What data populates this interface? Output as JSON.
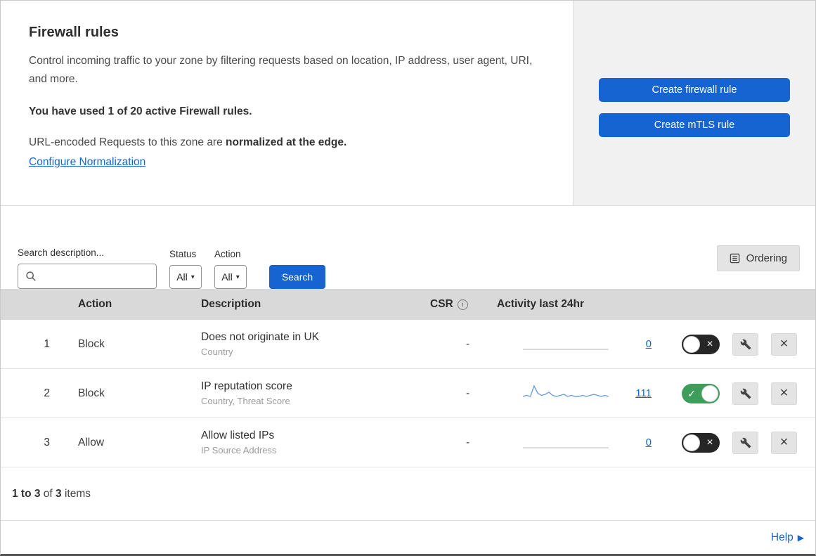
{
  "colors": {
    "accent_blue": "#1664d1",
    "link_blue": "#1664d1",
    "toggle_green": "#3f9d5c",
    "toggle_off_dark": "#262626",
    "table_header_gray": "#d9d9d9",
    "sparkline_blue": "#6d9ee3",
    "panel_gray": "#f1f1f1"
  },
  "header": {
    "title": "Firewall rules",
    "description": "Control incoming traffic to your zone by filtering requests based on location, IP address, user agent, URI, and more.",
    "usage": "You have used 1 of 20 active Firewall rules.",
    "normalization_text": "URL-encoded Requests to this zone are ",
    "normalization_bold": "normalized at the edge.",
    "normalization_link": "Configure Normalization",
    "create_firewall_rule": "Create firewall rule",
    "create_mtls_rule": "Create mTLS rule"
  },
  "filters": {
    "search_label": "Search description...",
    "status_label": "Status",
    "status_value": "All",
    "action_label": "Action",
    "action_value": "All",
    "search_button": "Search",
    "ordering_button": "Ordering"
  },
  "table": {
    "headers": {
      "action": "Action",
      "description": "Description",
      "csr": "CSR",
      "activity": "Activity last 24hr"
    },
    "rows": [
      {
        "priority": "1",
        "action": "Block",
        "description": "Does not originate in UK",
        "criteria": "Country",
        "csr": "-",
        "activity_count": "0",
        "enabled": false,
        "sparkline": [
          0,
          0,
          0,
          0,
          0,
          0,
          0,
          0,
          0,
          0,
          0,
          0,
          0,
          0,
          0,
          0,
          0,
          0,
          0,
          0,
          0,
          0,
          0,
          0
        ]
      },
      {
        "priority": "2",
        "action": "Block",
        "description": "IP reputation score",
        "criteria": "Country, Threat Score",
        "csr": "-",
        "activity_count": "111",
        "enabled": true,
        "sparkline": [
          2,
          3,
          2,
          12,
          5,
          3,
          4,
          6,
          3,
          2,
          3,
          4,
          2,
          3,
          2,
          2,
          3,
          2,
          3,
          4,
          3,
          2,
          3,
          2
        ]
      },
      {
        "priority": "3",
        "action": "Allow",
        "description": "Allow listed IPs",
        "criteria": "IP Source Address",
        "csr": "-",
        "activity_count": "0",
        "enabled": false,
        "sparkline": [
          0,
          0,
          0,
          0,
          0,
          0,
          0,
          0,
          0,
          0,
          0,
          0,
          0,
          0,
          0,
          0,
          0,
          0,
          0,
          0,
          0,
          0,
          0,
          0
        ]
      }
    ]
  },
  "footer": {
    "range": "1 to 3",
    "of": " of ",
    "total": "3",
    "items": " items",
    "help": "Help"
  },
  "icons": {
    "caret": "▾",
    "info": "i",
    "close": "×",
    "check": "✓",
    "help_arrow": "▶"
  }
}
